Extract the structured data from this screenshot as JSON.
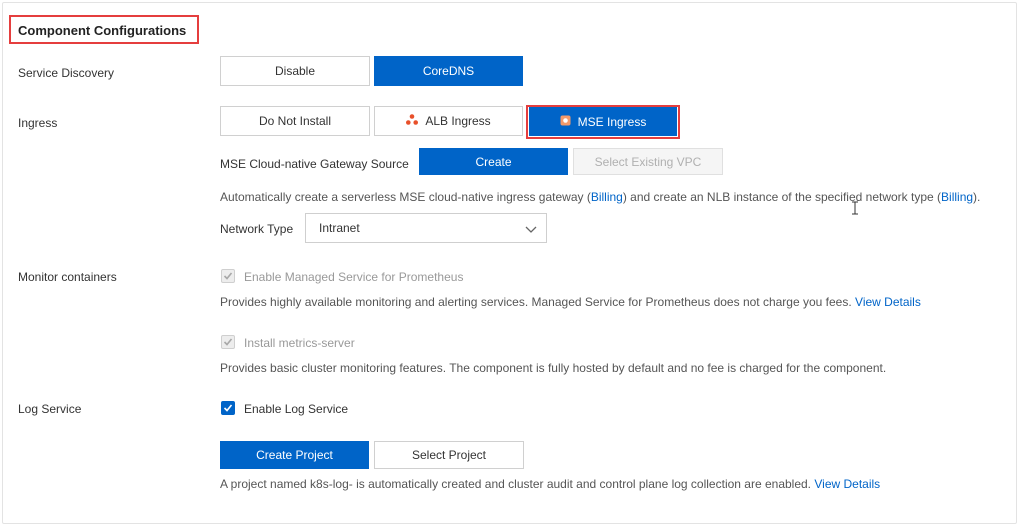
{
  "section": {
    "title": "Component Configurations"
  },
  "service_discovery": {
    "label": "Service Discovery",
    "options": [
      "Disable",
      "CoreDNS"
    ],
    "selected": "CoreDNS"
  },
  "ingress": {
    "label": "Ingress",
    "options": [
      "Do Not Install",
      "ALB Ingress",
      "MSE Ingress"
    ],
    "selected": "MSE Ingress",
    "gateway_source_label": "MSE Cloud-native Gateway Source",
    "gateway_source_options": [
      "Create",
      "Select Existing VPC"
    ],
    "gateway_source_selected": "Create",
    "desc_part1": "Automatically create a serverless MSE cloud-native ingress gateway (",
    "billing_link": "Billing",
    "desc_part2": ") and create an NLB instance of the specified network type (",
    "desc_part3": ").",
    "network_type_label": "Network Type",
    "network_type_value": "Intranet"
  },
  "monitor": {
    "label": "Monitor containers",
    "prometheus_label": "Enable Managed Service for Prometheus",
    "prometheus_checked": true,
    "prometheus_desc": "Provides highly available monitoring and alerting services. Managed Service for Prometheus does not charge you fees.",
    "view_details": "View Details",
    "metrics_label": "Install metrics-server",
    "metrics_checked": true,
    "metrics_desc": "Provides basic cluster monitoring features. The component is fully hosted by default and no fee is charged for the component."
  },
  "log_service": {
    "label": "Log Service",
    "enable_label": "Enable Log Service",
    "enable_checked": true,
    "options": [
      "Create Project",
      "Select Project"
    ],
    "selected": "Create Project",
    "desc": "A project named k8s-log- is automatically created and cluster audit and control plane log collection are enabled.",
    "view_details": "View Details"
  },
  "colors": {
    "primary": "#0064c8",
    "highlight": "#e53e3e",
    "alb_icon": "#e8502a",
    "mse_icon": "#f39a6b"
  }
}
